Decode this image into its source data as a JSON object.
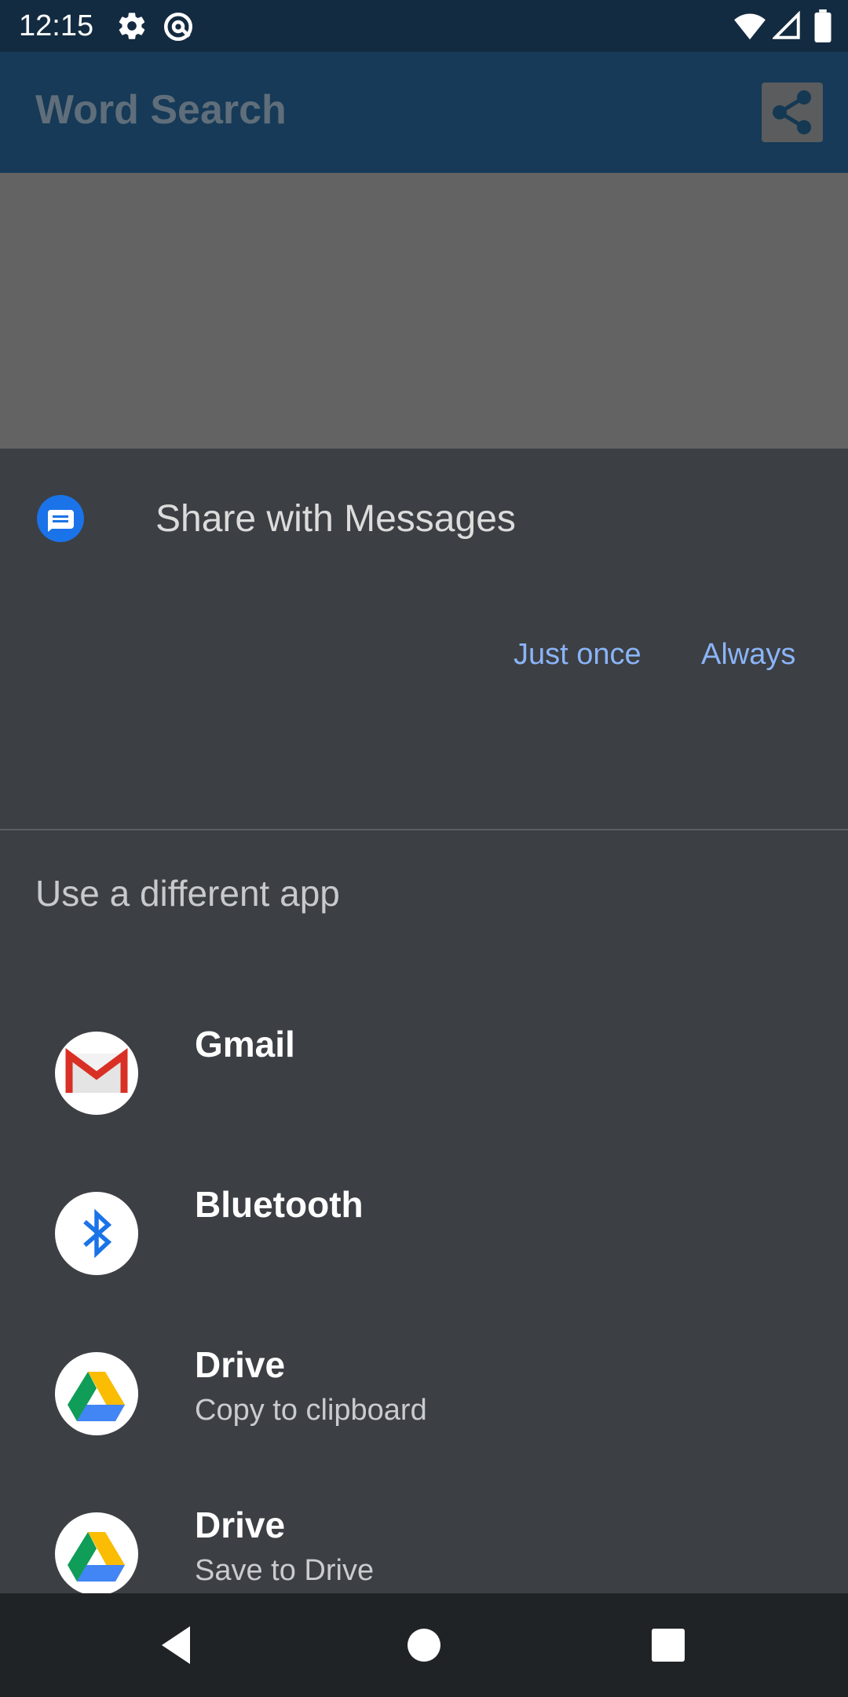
{
  "status_bar": {
    "time": "12:15",
    "icons": [
      "gear-icon",
      "at-sync-icon",
      "wifi-icon",
      "signal-icon",
      "battery-icon"
    ]
  },
  "app_bar": {
    "title": "Word Search",
    "share_icon": "share-icon"
  },
  "share_sheet": {
    "default_app": {
      "title": "Share with Messages",
      "icon": "messages-icon"
    },
    "actions": {
      "just_once": "Just once",
      "always": "Always"
    },
    "section_title": "Use a different app",
    "apps": [
      {
        "name": "Gmail",
        "subtitle": "",
        "icon": "gmail-icon"
      },
      {
        "name": "Bluetooth",
        "subtitle": "",
        "icon": "bluetooth-icon"
      },
      {
        "name": "Drive",
        "subtitle": "Copy to clipboard",
        "icon": "drive-icon"
      },
      {
        "name": "Drive",
        "subtitle": "Save to Drive",
        "icon": "drive-icon"
      }
    ]
  },
  "nav_bar": {
    "buttons": [
      "back-icon",
      "home-icon",
      "recents-icon"
    ]
  },
  "colors": {
    "status_bar": "#132b41",
    "app_bar_dimmed": "#163a57",
    "sheet_background": "#3c3f43",
    "accent": "#8ab4f8",
    "nav_bar": "#202326"
  }
}
